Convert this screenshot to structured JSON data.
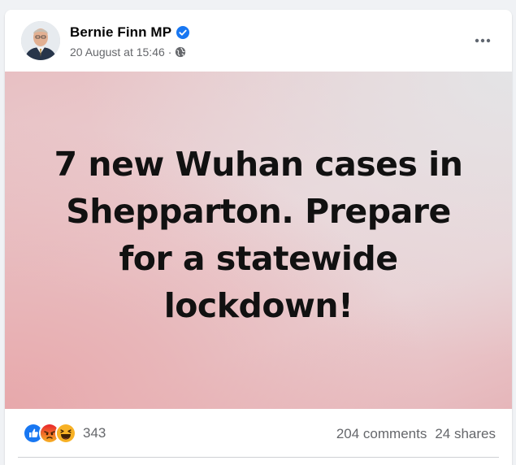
{
  "post": {
    "author": {
      "name": "Bernie Finn MP",
      "verified": true,
      "avatar": "author-avatar"
    },
    "timestamp": "20 August at 15:46",
    "separator": "·",
    "privacy_icon": "globe-icon",
    "more_icon": "more-options-icon",
    "image": {
      "lines": [
        "7 new Wuhan cases in",
        "Shepparton. Prepare",
        "for a statewide",
        "lockdown!"
      ]
    },
    "reactions": {
      "types": [
        "like",
        "angry",
        "haha"
      ],
      "count": "343"
    },
    "comments": "204 comments",
    "shares": "24 shares"
  },
  "colors": {
    "brand_blue": "#1877f2",
    "text_primary": "#050505",
    "text_secondary": "#65676b",
    "angry_orange": "#e9710f",
    "haha_yellow": "#f7b125"
  }
}
